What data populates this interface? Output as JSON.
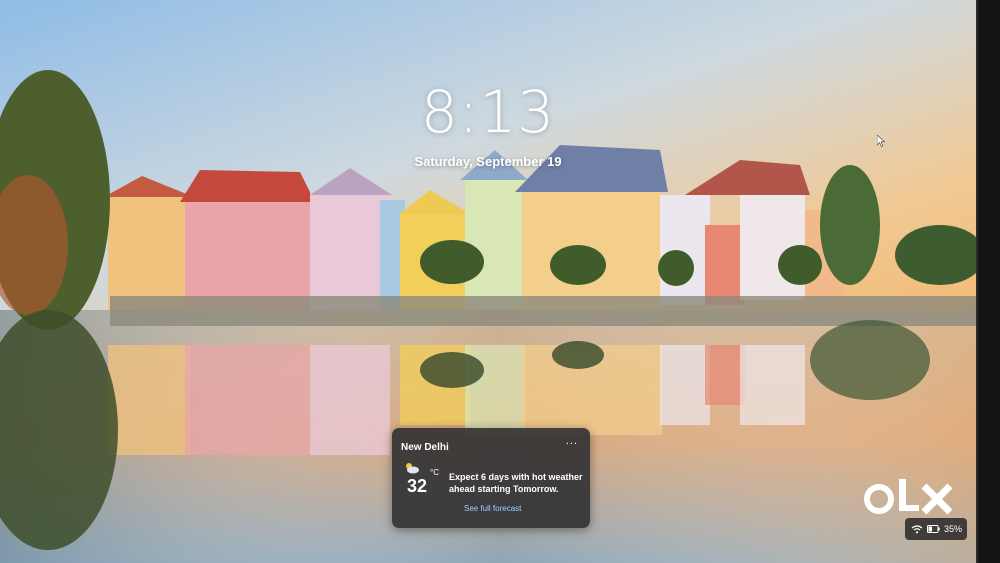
{
  "lock_screen": {
    "time": "8:13",
    "date": "Saturday, September 19"
  },
  "weather_widget": {
    "location": "New Delhi",
    "more_label": "...",
    "temperature": "32",
    "unit": "°C",
    "description": "Expect 6 days with hot weather ahead starting Tomorrow.",
    "link_label": "See full forecast",
    "icon": "partly-cloudy-icon"
  },
  "status": {
    "network_icon": "wifi-icon",
    "battery_icon": "battery-icon",
    "battery_percent": "35%"
  },
  "watermark": {
    "text": "OLX"
  },
  "colors": {
    "sky_top": "#9fc4e6",
    "sky_horizon": "#f3c88e",
    "water": "#d9a876",
    "widget_bg": "#303032",
    "link": "#9fd0ff"
  }
}
